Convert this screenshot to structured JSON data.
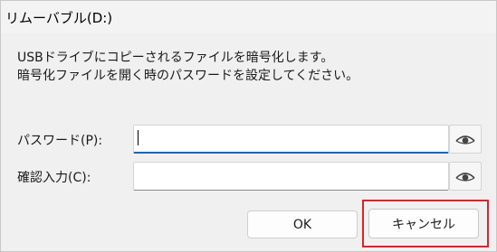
{
  "window": {
    "title": "リムーバブル(D:)"
  },
  "message": {
    "line1": "USBドライブにコピーされるファイルを暗号化します。",
    "line2": "暗号化ファイルを開く時のパスワードを設定してください。"
  },
  "password": {
    "label": "パスワード(P):",
    "value": ""
  },
  "confirm": {
    "label": "確認入力(C):",
    "value": ""
  },
  "icons": {
    "reveal": "eye-icon"
  },
  "buttons": {
    "ok": "OK",
    "cancel": "キャンセル"
  },
  "colors": {
    "focus": "#0067c0",
    "highlight": "#e0202a"
  }
}
